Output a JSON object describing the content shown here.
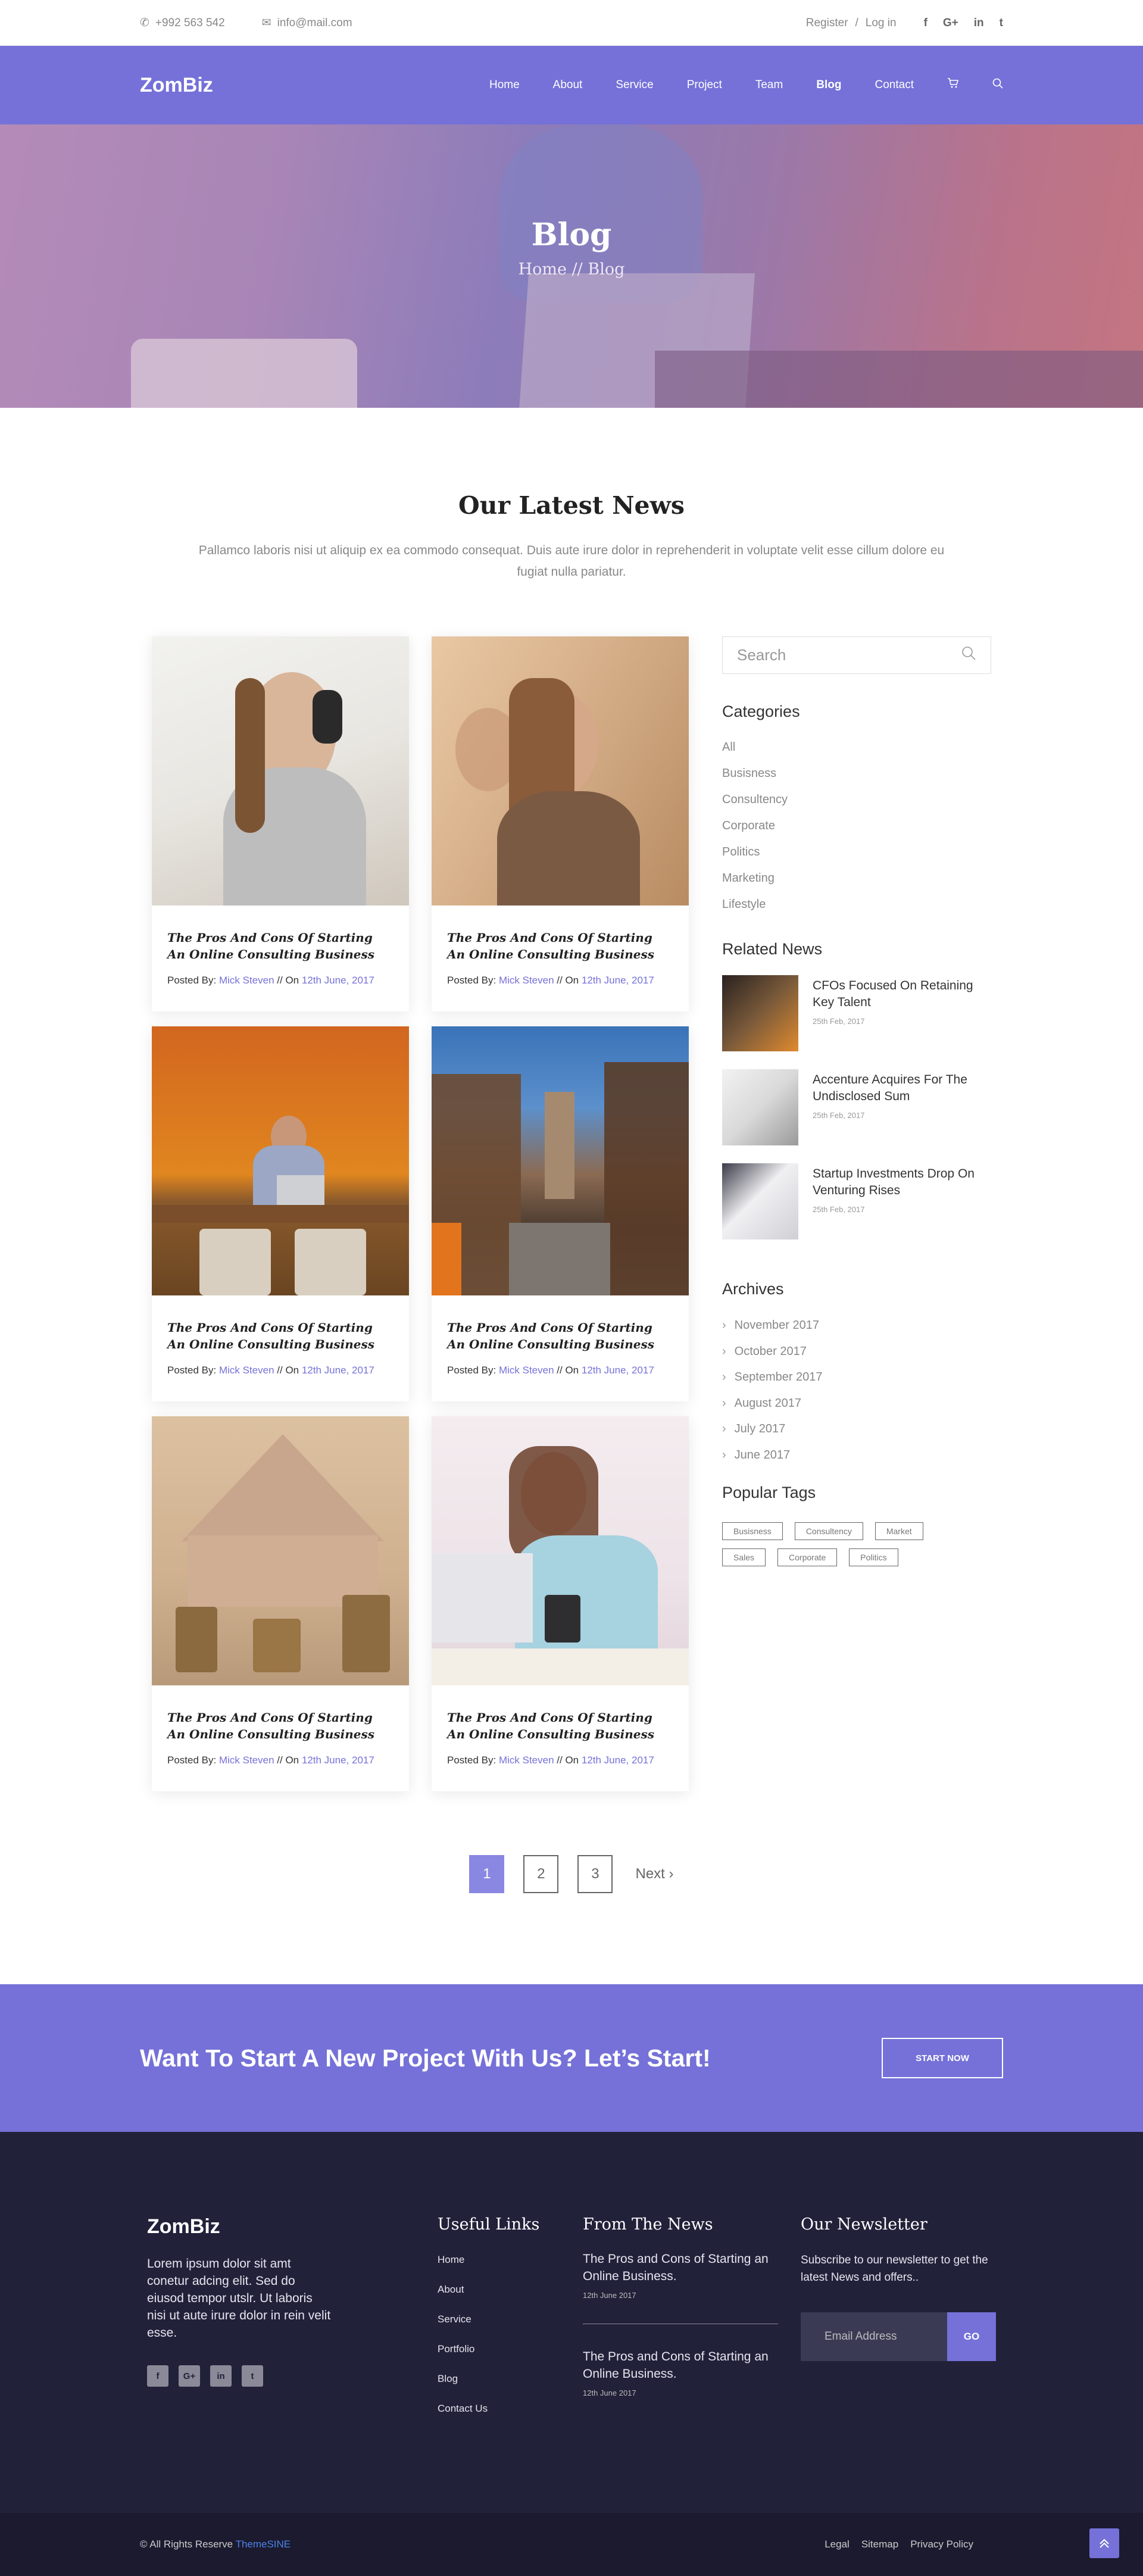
{
  "topbar": {
    "phone": "+992 563 542",
    "email": "info@mail.com",
    "register": "Register",
    "sep": "/",
    "login": "Log in",
    "social": [
      "f",
      "G+",
      "in",
      "t"
    ]
  },
  "nav": {
    "logo": "ZomBiz",
    "items": [
      "Home",
      "About",
      "Service",
      "Project",
      "Team",
      "Blog",
      "Contact"
    ],
    "active": "Blog"
  },
  "hero": {
    "title": "Blog",
    "breadcrumb": "Home // Blog"
  },
  "news": {
    "title": "Our Latest News",
    "subtitle": "Pallamco laboris nisi ut aliquip ex ea commodo consequat. Duis aute irure dolor in reprehenderit in voluptate velit esse cillum dolore eu fugiat nulla pariatur.",
    "posts": [
      {
        "title": "The Pros And Cons Of Starting An Online Consulting Business",
        "by": "Posted By:",
        "author": "Mick Steven",
        "on": "// On",
        "date": "12th June, 2017"
      },
      {
        "title": "The Pros And Cons Of Starting An Online Consulting Business",
        "by": "Posted By:",
        "author": "Mick Steven",
        "on": "// On",
        "date": "12th June, 2017"
      },
      {
        "title": "The Pros And Cons Of Starting An Online Consulting Business",
        "by": "Posted By:",
        "author": "Mick Steven",
        "on": "// On",
        "date": "12th June, 2017"
      },
      {
        "title": "The Pros And Cons Of Starting An Online Consulting Business",
        "by": "Posted By:",
        "author": "Mick Steven",
        "on": "// On",
        "date": "12th June, 2017"
      },
      {
        "title": "The Pros And Cons Of Starting An Online Consulting Business",
        "by": "Posted By:",
        "author": "Mick Steven",
        "on": "// On",
        "date": "12th June, 2017"
      },
      {
        "title": "The Pros And Cons Of Starting An Online Consulting Business",
        "by": "Posted By:",
        "author": "Mick Steven",
        "on": "// On",
        "date": "12th June, 2017"
      }
    ]
  },
  "sidebar": {
    "search_placeholder": "Search",
    "categories_title": "Categories",
    "categories": [
      "All",
      "Busisness",
      "Consultency",
      "Corporate",
      "Politics",
      "Marketing",
      "Lifestyle"
    ],
    "related_title": "Related News",
    "related": [
      {
        "title": "CFOs Focused On Retaining Key Talent",
        "date": "25th Feb, 2017"
      },
      {
        "title": "Accenture Acquires For The Undisclosed Sum",
        "date": "25th Feb, 2017"
      },
      {
        "title": "Startup Investments Drop On Venturing Rises",
        "date": "25th Feb, 2017"
      }
    ],
    "archives_title": "Archives",
    "archives": [
      "November 2017",
      "October 2017",
      "September 2017",
      "August 2017",
      "July 2017",
      "June 2017"
    ],
    "tags_title": "Popular Tags",
    "tags": [
      "Busisness",
      "Consultency",
      "Market",
      "Sales",
      "Corporate",
      "Politics"
    ]
  },
  "pagination": {
    "pages": [
      "1",
      "2",
      "3"
    ],
    "current": "1",
    "next": "Next"
  },
  "cta": {
    "title": "Want To Start A New Project With Us? Let’s Start!",
    "button": "START NOW"
  },
  "footer": {
    "logo": "ZomBiz",
    "about": "Lorem ipsum dolor sit amt conetur adcing elit. Sed do eiusod tempor utslr. Ut laboris nisi ut aute irure dolor in rein velit esse.",
    "social": [
      "f",
      "G+",
      "in",
      "t"
    ],
    "links_title": "Useful Links",
    "links": [
      "Home",
      "About",
      "Service",
      "Portfolio",
      "Blog",
      "Contact Us"
    ],
    "news_title": "From The News",
    "news": [
      {
        "title": "The Pros and Cons of Starting an Online Business.",
        "date": "12th June 2017"
      },
      {
        "title": "The Pros and Cons of Starting an Online Business.",
        "date": "12th June 2017"
      }
    ],
    "newsletter_title": "Our Newsletter",
    "newsletter_text": "Subscribe to our newsletter to get the latest News and offers..",
    "email_placeholder": "Email Address",
    "go": "GO"
  },
  "bottom": {
    "copyright": "© All Rights Reserve",
    "brand": "ThemeSINE",
    "links": [
      "Legal",
      "Sitemap",
      "Privacy Policy"
    ]
  },
  "colors": {
    "accent": "#7571d8",
    "footer_bg": "#22213a"
  }
}
